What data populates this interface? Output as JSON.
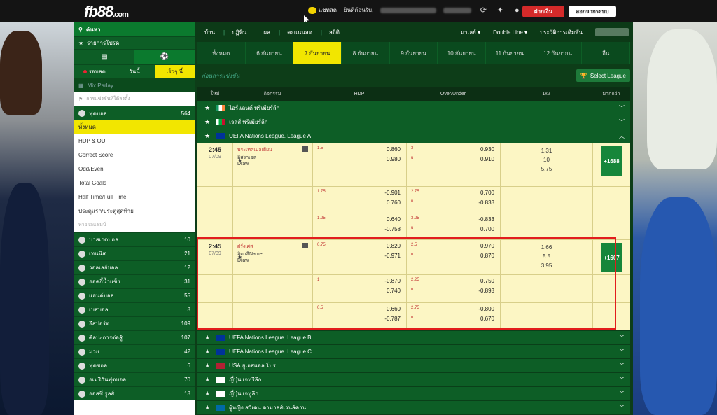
{
  "header": {
    "logo_main": "fb88",
    "logo_suffix": ".com",
    "chat_label": "แชทสด",
    "welcome": "ยินดีต้อนรับ,",
    "deposit": "ฝากเงิน",
    "logout": "ออกจากระบบ"
  },
  "sidebar": {
    "search": "ค้นหา",
    "favorites": "รายการโปรด",
    "tabs": [
      "รอบสด",
      "วันนี้",
      "เร็วๆ นี้"
    ],
    "mix_parlay": "Mix Parlay",
    "competitions": "การแข่งขันที่ได้ลงตั้ง",
    "football": {
      "label": "ฟุตบอล",
      "count": "564"
    },
    "sub": [
      "ทั้งหมด",
      "HDP & OU",
      "Correct Score",
      "Odd/Even",
      "Total Goals",
      "Half Time/Full Time",
      "ประตูแรก/ประตูสุดท้าย",
      "ทายผลแชมป์"
    ],
    "sports": [
      {
        "label": "บาสเกตบอล",
        "count": "10"
      },
      {
        "label": "เทนนิส",
        "count": "21"
      },
      {
        "label": "วอลเลย์บอล",
        "count": "12"
      },
      {
        "label": "ฮอคกี้น้ำแข็ง",
        "count": "31"
      },
      {
        "label": "แฮนด์บอล",
        "count": "55"
      },
      {
        "label": "เบสบอล",
        "count": "8"
      },
      {
        "label": "อีสปอร์ต",
        "count": "109"
      },
      {
        "label": "ศิลปะการต่อสู้",
        "count": "107"
      },
      {
        "label": "มวย",
        "count": "42"
      },
      {
        "label": "ฟุตซอล",
        "count": "6"
      },
      {
        "label": "อเมริกันฟุตบอล",
        "count": "70"
      },
      {
        "label": "ออสซี่ รูลส์",
        "count": "18"
      }
    ]
  },
  "main": {
    "nav": [
      "บ้าน",
      "ปฏิทิน",
      "ผล",
      "คะแนนสด",
      "สถิติ"
    ],
    "nav_right": [
      "มาเลย์",
      "Double Line",
      "ประวัติการเดิมพัน"
    ],
    "dates": [
      "ทั้งหมด",
      "6 กันยายน",
      "7 กันยายน",
      "8 กันยายน",
      "9 กันยายน",
      "10 กันยายน",
      "11 กันยายน",
      "12 กันยายน",
      "อื่น"
    ],
    "league_title": "ก่อนการแข่งขัน",
    "select_league": "Select League",
    "headers": [
      "ใหม่",
      "กิจกรรม",
      "HDP",
      "Over/Under",
      "1x2",
      "มากกว่า"
    ],
    "leagues_top": [
      "ไอร์แลนด์ พรีเมียร์ลีก",
      "เวลส์ พรีเมียร์ลีก",
      "UEFA Nations League. League A"
    ],
    "events": [
      {
        "time": "2:45",
        "date": "07/09",
        "home": "ประเทศเบลเยียม",
        "away": "อิสราเอล",
        "draw": "Draw",
        "more": "+1688",
        "lines": [
          {
            "hl": "1.5",
            "h1": "0.860",
            "h2": "0.980",
            "ol": "3",
            "ou": "u",
            "o1": "0.930",
            "o2": "0.910",
            "x": [
              "1.31",
              "10",
              "5.75"
            ]
          },
          {
            "hl": "1.75",
            "h1": "-0.901",
            "h2": "0.760",
            "ol": "2.75",
            "ou": "u",
            "o1": "0.700",
            "o2": "-0.833",
            "x": []
          },
          {
            "hl": "1.25",
            "h1": "0.640",
            "h2": "-0.758",
            "ol": "3.25",
            "ou": "u",
            "o1": "-0.833",
            "o2": "0.700",
            "x": []
          }
        ]
      },
      {
        "time": "2:45",
        "date": "07/09",
        "home": "ฝรั่งเศส",
        "away": "อิตาลีName",
        "draw": "Draw",
        "more": "+1607",
        "lines": [
          {
            "hl": "0.75",
            "h1": "0.820",
            "h2": "-0.971",
            "ol": "2.5",
            "ou": "u",
            "o1": "0.970",
            "o2": "0.870",
            "x": [
              "1.66",
              "5.5",
              "3.95"
            ]
          },
          {
            "hl": "1",
            "h1": "-0.870",
            "h2": "0.740",
            "ol": "2.25",
            "ou": "u",
            "o1": "0.750",
            "o2": "-0.893",
            "x": []
          },
          {
            "hl": "0.5",
            "h1": "0.660",
            "h2": "-0.787",
            "ol": "2.75",
            "ou": "u",
            "o1": "-0.800",
            "o2": "0.670",
            "x": []
          }
        ]
      }
    ],
    "leagues_bottom": [
      "UEFA Nations League. League B",
      "UEFA Nations League. League C",
      "USA.ยูเอสแอล โปร",
      "ญี่ปุ่น เจทรีลีก",
      "ญี่ปุ่น เจทูลีก",
      "ผู้หญิง สวีเดน ดามาลส์เวนส์คาน"
    ]
  }
}
